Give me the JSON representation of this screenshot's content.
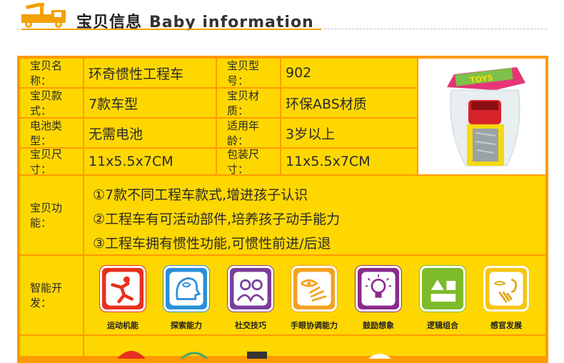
{
  "header": {
    "title_cn": "宝贝信息",
    "title_en": "Baby information"
  },
  "specs": [
    {
      "label": "宝贝名称：",
      "value": "环奇惯性工程车"
    },
    {
      "label": "宝贝型号：",
      "value": "902"
    },
    {
      "label": "宝贝款式：",
      "value": "7款车型"
    },
    {
      "label": "宝贝材质：",
      "value": "环保ABS材质"
    },
    {
      "label": "电池类型：",
      "value": "无需电池"
    },
    {
      "label": "适用年龄：",
      "value": "3岁以上"
    },
    {
      "label": "宝贝尺寸：",
      "value": "11x5.5x7CM"
    },
    {
      "label": "包装尺寸：",
      "value": "11x5.5x7CM"
    }
  ],
  "function": {
    "label": "宝贝功能：",
    "lines": [
      "①7款不同工程车款式,增进孩子认识",
      "②工程车有可活动部件,培养孩子动手能力",
      "③工程车拥有惯性功能,可惯性前进/后退"
    ]
  },
  "development": {
    "label": "智能开发：",
    "items": [
      {
        "label": "运动机能",
        "icon": "running-person-icon",
        "color": "#e8301f"
      },
      {
        "label": "探索能力",
        "icon": "explore-head-icon",
        "color": "#2a8fd8"
      },
      {
        "label": "社交技巧",
        "icon": "social-people-icon",
        "color": "#7b3d9a"
      },
      {
        "label": "手眼协调能力",
        "icon": "eye-hand-icon",
        "color": "#f3a21f"
      },
      {
        "label": "鼓励想象",
        "icon": "lightbulb-icon",
        "color": "#8a2b8c"
      },
      {
        "label": "逻辑组合",
        "icon": "logic-blocks-icon",
        "color": "#7dbb2a"
      },
      {
        "label": "感官发展",
        "icon": "senses-icon",
        "color": "#f6c512"
      }
    ]
  },
  "colors": {
    "frame": "#ff9a00",
    "cell": "#ffd700",
    "accent": "#f2a100"
  }
}
